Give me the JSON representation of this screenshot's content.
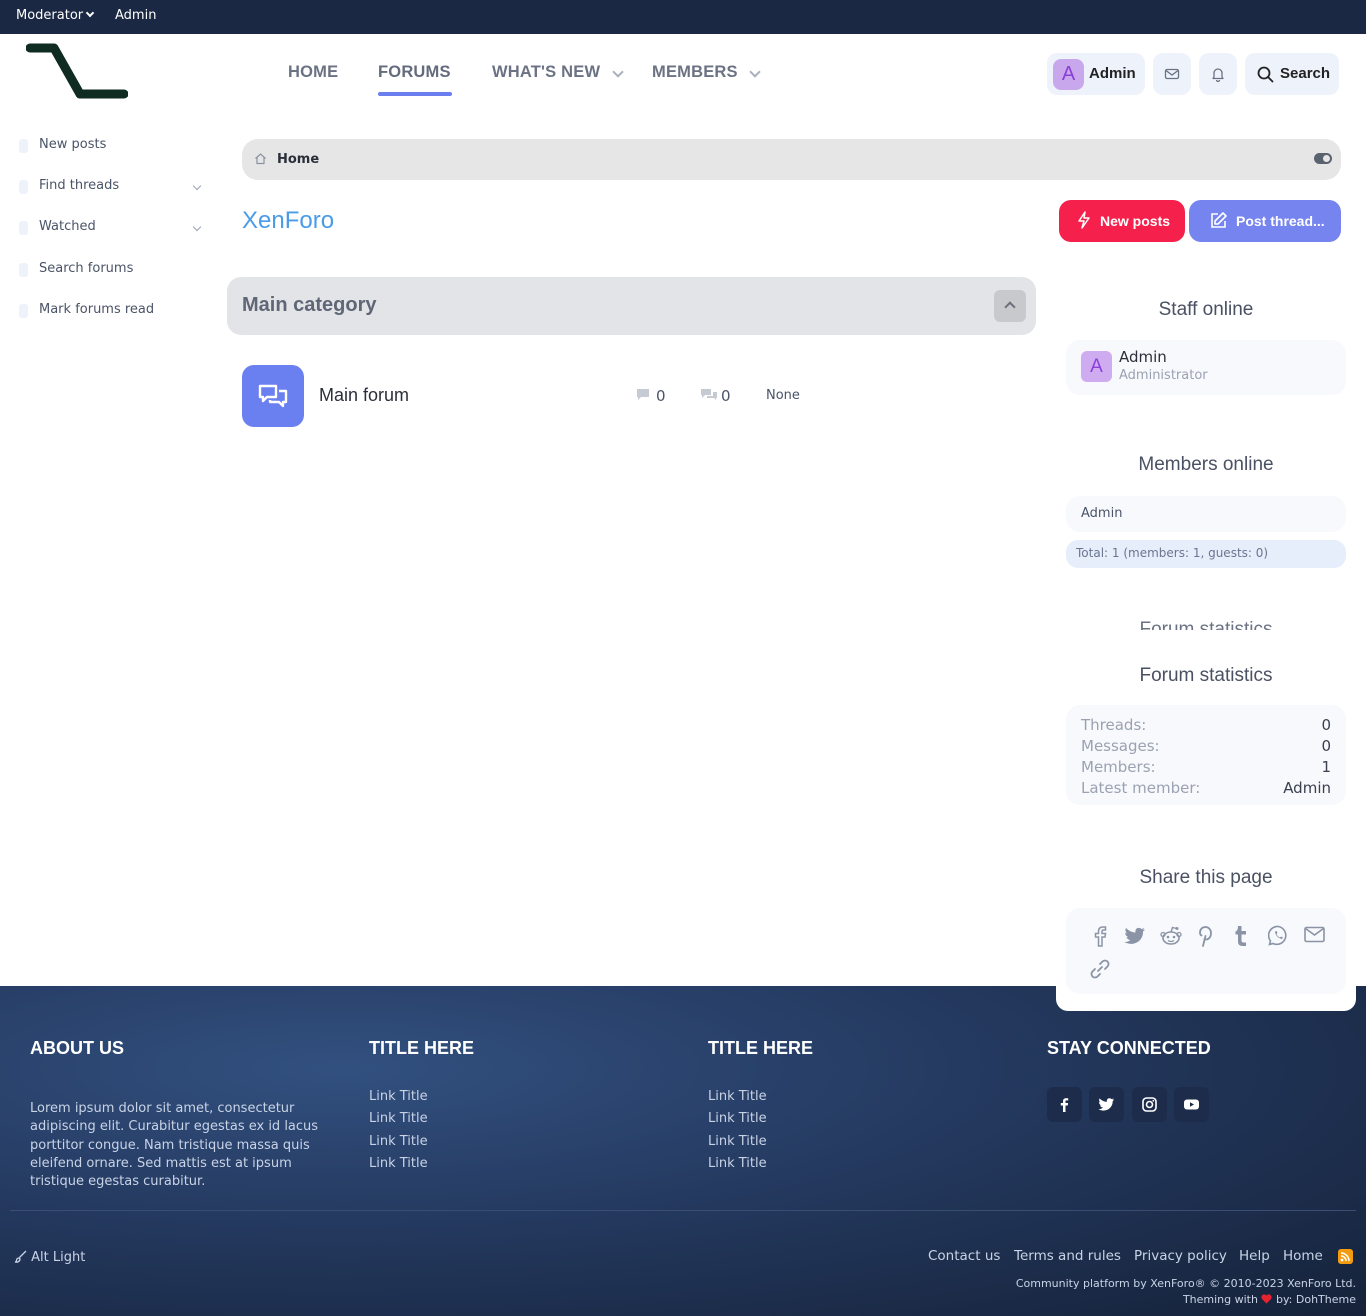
{
  "staffbar": {
    "moderator": "Moderator",
    "admin": "Admin"
  },
  "nav": {
    "home": "HOME",
    "forums": "FORUMS",
    "whats_new": "WHAT'S NEW",
    "members": "MEMBERS"
  },
  "user": {
    "avatar_letter": "A",
    "name": "Admin"
  },
  "search_label": "Search",
  "sidebar": {
    "items": [
      "New posts",
      "Find threads",
      "Watched",
      "Search forums",
      "Mark forums read"
    ]
  },
  "breadcrumb": {
    "home": "Home"
  },
  "page": {
    "title": "XenForo"
  },
  "buttons": {
    "new_posts": "New posts",
    "post_thread": "Post thread..."
  },
  "category": {
    "title": "Main category"
  },
  "forum": {
    "name": "Main forum",
    "threads": "0",
    "messages": "0",
    "last_post": "None"
  },
  "staff_online": {
    "title": "Staff online",
    "avatar_letter": "A",
    "name": "Admin",
    "role": "Administrator"
  },
  "members_online": {
    "title": "Members online",
    "member": "Admin",
    "total": "Total: 1 (members: 1, guests: 0)"
  },
  "forum_statistics": {
    "title": "Forum statistics",
    "rows": [
      {
        "label": "Threads:",
        "value": "0"
      },
      {
        "label": "Messages:",
        "value": "0"
      },
      {
        "label": "Members:",
        "value": "1"
      },
      {
        "label": "Latest member:",
        "value": "Admin"
      }
    ]
  },
  "share": {
    "title": "Share this page",
    "icons": [
      "facebook-icon",
      "twitter-icon",
      "reddit-icon",
      "pinterest-icon",
      "tumblr-icon",
      "whatsapp-icon",
      "email-icon",
      "link-icon"
    ]
  },
  "footer": {
    "about_title": "ABOUT US",
    "about_text": "Lorem ipsum dolor sit amet, consectetur adipiscing elit. Curabitur egestas ex id lacus porttitor congue. Nam tristique massa quis eleifend ornare. Sed mattis est at ipsum tristique egestas curabitur.",
    "col2_title": "TITLE HERE",
    "col2_links": [
      "Link Title",
      "Link Title",
      "Link Title",
      "Link Title"
    ],
    "col3_title": "TITLE HERE",
    "col3_links": [
      "Link Title",
      "Link Title",
      "Link Title",
      "Link Title"
    ],
    "connect_title": "STAY CONNECTED",
    "style_chooser": "Alt Light",
    "links": [
      "Contact us",
      "Terms and rules",
      "Privacy policy",
      "Help",
      "Home"
    ],
    "copyright": "Community platform by XenForo® © 2010-2023 XenForo Ltd.",
    "theme_prefix": "Theming with",
    "theme_suffix": "by: DohTheme"
  },
  "colors": {
    "accent": "#6b7ef0",
    "new_posts": "#f5214c",
    "post_thread": "#7684ef",
    "topbar": "#1b2844"
  }
}
